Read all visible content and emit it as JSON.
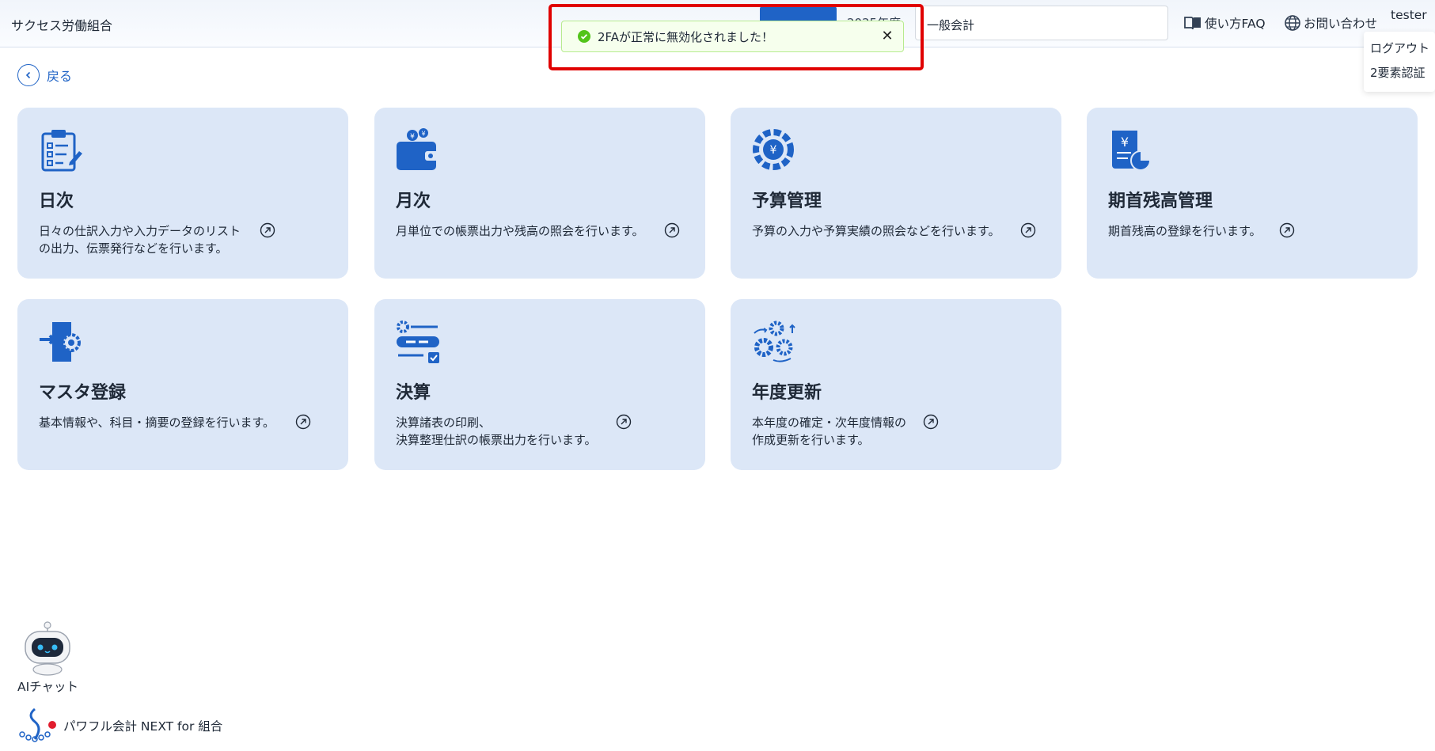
{
  "header": {
    "org_name": "サクセス労働組合",
    "fiscal_year": "2025年度",
    "account_select": "一般会計",
    "faq": "使い方FAQ",
    "contact": "お問い合わせ",
    "user": "tester",
    "user_menu": {
      "logout": "ログアウト",
      "two_factor": "2要素認証"
    }
  },
  "toast": {
    "message": "2FAが正常に無効化されました！",
    "close": "✕"
  },
  "back": "戻る",
  "cards": [
    {
      "title": "日次",
      "desc_line1": "日々の仕訳入力や入力データのリスト",
      "desc_line2": "の出力、伝票発行などを行います。"
    },
    {
      "title": "月次",
      "desc_line1": "月単位での帳票出力や残高の照会を行います。",
      "desc_line2": ""
    },
    {
      "title": "予算管理",
      "desc_line1": "予算の入力や予算実績の照会などを行います。",
      "desc_line2": ""
    },
    {
      "title": "期首残高管理",
      "desc_line1": "期首残高の登録を行います。",
      "desc_line2": ""
    },
    {
      "title": "マスタ登録",
      "desc_line1": "基本情報や、科目・摘要の登録を行います。",
      "desc_line2": ""
    },
    {
      "title": "決算",
      "desc_line1": "決算諸表の印刷、",
      "desc_line2": "決算整理仕訳の帳票出力を行います。"
    },
    {
      "title": "年度更新",
      "desc_line1": "本年度の確定・次年度情報の",
      "desc_line2": "作成更新を行います。"
    }
  ],
  "ai_chat": "AIチャット",
  "brand": "パワフル会計 NEXT for 組合",
  "colors": {
    "primary": "#1f63c6",
    "card_bg": "#dce7f7",
    "toast_bg": "#f6ffed",
    "alert_frame": "#e00000"
  }
}
